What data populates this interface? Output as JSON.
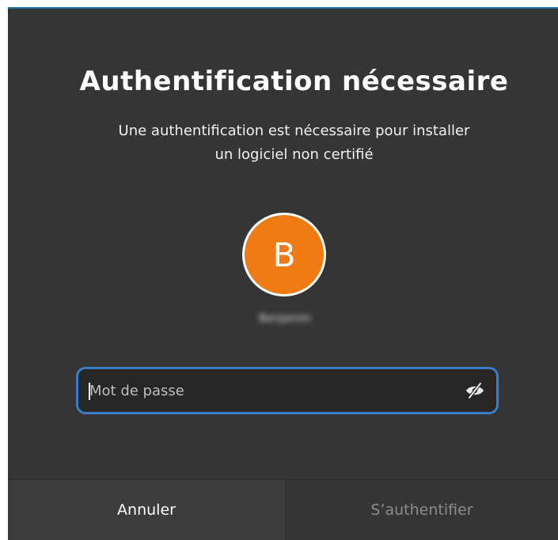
{
  "dialog": {
    "title": "Authentification nécessaire",
    "message_line1": "Une authentification est nécessaire pour installer",
    "message_line2": "un logiciel non certifié"
  },
  "user": {
    "avatar_letter": "B",
    "avatar_color": "#f07a14",
    "name": "Benjamin"
  },
  "password": {
    "placeholder": "Mot de passe",
    "value": "",
    "toggle_icon": "eye-slash-icon"
  },
  "buttons": {
    "cancel_label": "Annuler",
    "authenticate_label": "S’authentifier"
  },
  "colors": {
    "background": "#353535",
    "focus_border": "#3a7dc9",
    "disabled_text": "#8c8c8c"
  }
}
